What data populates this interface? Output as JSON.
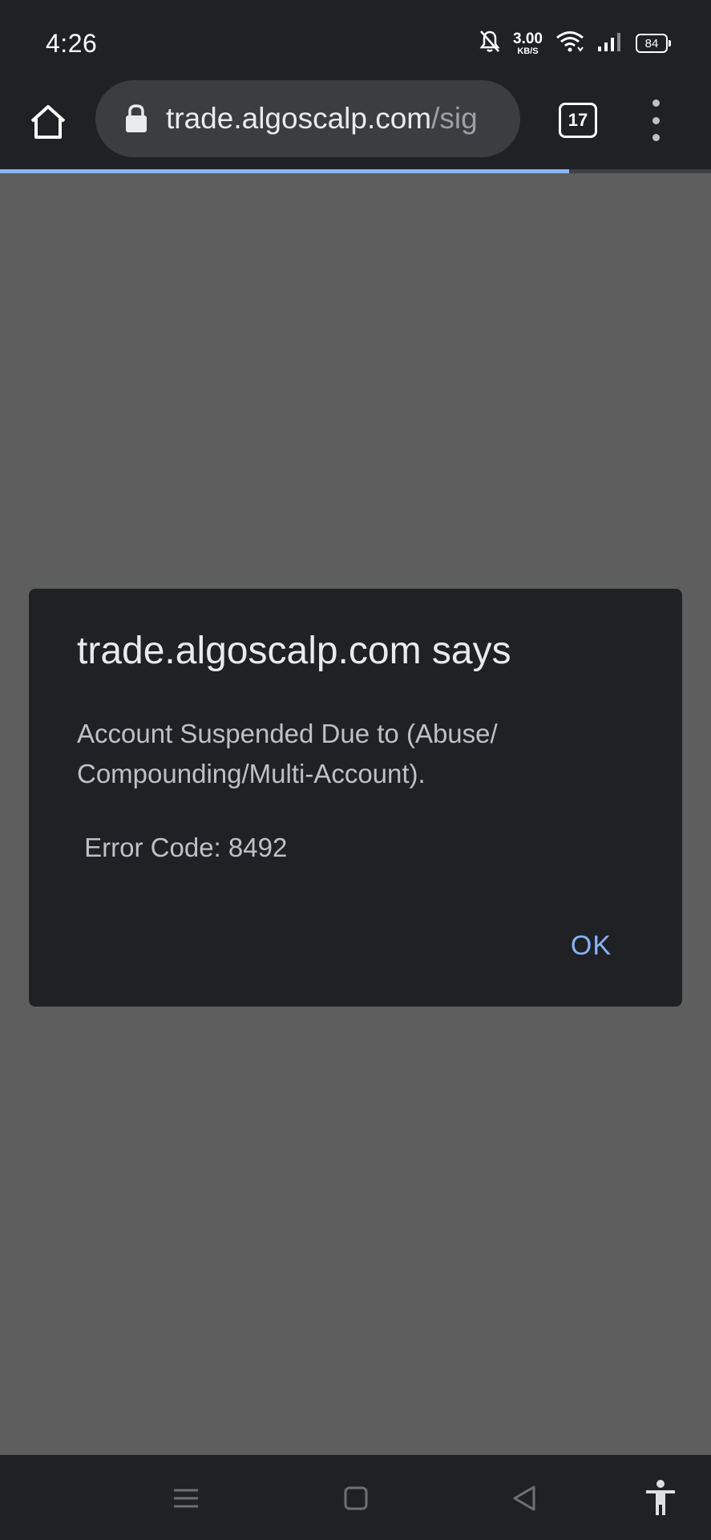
{
  "status_bar": {
    "time": "4:26",
    "net_speed_value": "3.00",
    "net_speed_unit": "KB/S",
    "battery_level": "84"
  },
  "toolbar": {
    "url_domain": "trade.algoscalp.com",
    "url_path": "/sig",
    "tab_count": "17",
    "load_progress_percent": 80
  },
  "dialog": {
    "title": "trade.algoscalp.com says",
    "message": "Account Suspended Due to (Abuse/ Compounding/Multi-Account).",
    "error_text": " Error Code: 8492",
    "ok_label": "OK"
  },
  "colors": {
    "chrome_dark": "#202124",
    "page_dim": "#5e5e5e",
    "accent_blue": "#8ab4f8"
  },
  "icons": {
    "home": "home-icon",
    "lock": "lock-icon",
    "tabs": "tab-switcher-icon",
    "menu": "more-vert-icon",
    "nav_menu": "hamburger-icon",
    "nav_home": "square-icon",
    "nav_back": "triangle-back-icon",
    "accessibility": "accessibility-icon"
  }
}
